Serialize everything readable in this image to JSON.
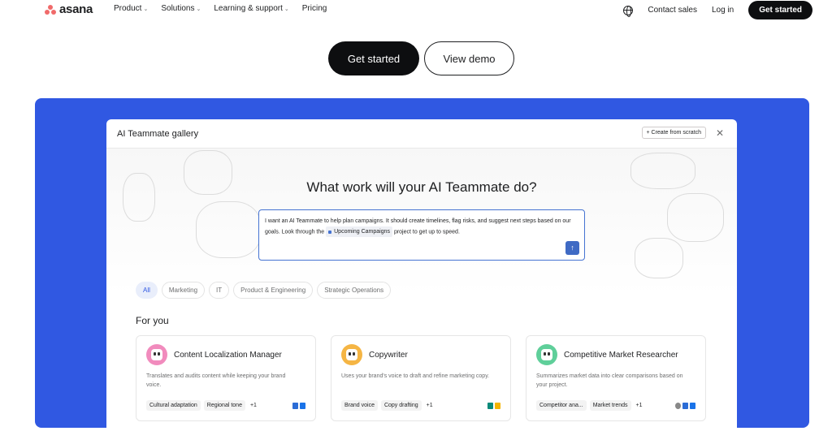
{
  "nav": {
    "logo_text": "asana",
    "links": [
      {
        "label": "Product",
        "has_menu": true
      },
      {
        "label": "Solutions",
        "has_menu": true
      },
      {
        "label": "Learning & support",
        "has_menu": true
      },
      {
        "label": "Pricing",
        "has_menu": false
      }
    ],
    "chevron": "⌄",
    "contact_sales": "Contact sales",
    "login": "Log in",
    "cta": "Get started"
  },
  "hero": {
    "primary_button": "Get started",
    "secondary_button": "View demo"
  },
  "dialog": {
    "title": "AI Teammate gallery",
    "create_button": "+ Create from scratch",
    "close_glyph": "✕",
    "prompt_heading": "What work will your AI Teammate do?",
    "prompt_text_before": "I want an AI Teammate to help plan campaigns. It should create timelines, flag risks, and suggest next steps based on our goals. Look through the ",
    "prompt_project": "Upcoming Campaigns",
    "prompt_text_after": " project to get up to speed.",
    "send_glyph": "↑",
    "filters": [
      "All",
      "Marketing",
      "IT",
      "Product & Engineering",
      "Strategic Operations"
    ],
    "active_filter": "All",
    "section_title": "For you",
    "cards": [
      {
        "title": "Content Localization Manager",
        "description": "Translates and audits content while keeping your brand voice.",
        "tags": [
          "Cultural adaptation",
          "Regional tone"
        ],
        "more": "+1",
        "avatar_color": "#f18bbd",
        "apps": [
          "#2b6cd6",
          "#1a73e8"
        ]
      },
      {
        "title": "Copywriter",
        "description": "Uses your brand's voice to draft and refine marketing copy.",
        "tags": [
          "Brand voice",
          "Copy drafting"
        ],
        "more": "+1",
        "avatar_color": "#f5b544",
        "apps": [
          "#0b8a7a",
          "#f4b400"
        ]
      },
      {
        "title": "Competitive Market Researcher",
        "description": "Summarizes market data into clear comparisons based on your project.",
        "tags": [
          "Competitor ana...",
          "Market trends"
        ],
        "more": "+1",
        "avatar_color": "#5fcf9a",
        "apps": [
          "#888888",
          "#2b6cd6",
          "#1a73e8"
        ]
      }
    ]
  },
  "colors": {
    "brand_blue": "#3058e2",
    "accent_coral": "#f06a6a",
    "dark": "#0d0e10"
  }
}
